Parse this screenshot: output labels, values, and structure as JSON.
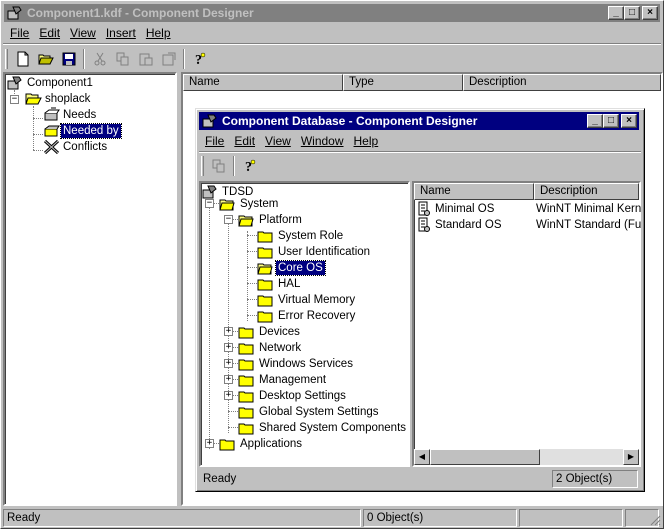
{
  "main": {
    "title": "Component1.kdf - Component Designer",
    "menu": [
      "File",
      "Edit",
      "View",
      "Insert",
      "Help"
    ],
    "tree": [
      {
        "label": "Component1"
      },
      {
        "label": "shoplack"
      },
      {
        "label": "Needs"
      },
      {
        "label": "Needed by"
      },
      {
        "label": "Conflicts"
      }
    ],
    "columns": [
      "Name",
      "Type",
      "Description"
    ],
    "status": [
      "Ready",
      "0 Object(s)",
      "",
      ""
    ]
  },
  "child": {
    "title": "Component Database - Component Designer",
    "menu": [
      "File",
      "Edit",
      "View",
      "Window",
      "Help"
    ],
    "tree": [
      {
        "label": "TDSD"
      },
      {
        "label": "System"
      },
      {
        "label": "Platform"
      },
      {
        "label": "System Role"
      },
      {
        "label": "User Identification"
      },
      {
        "label": "Core OS"
      },
      {
        "label": "HAL"
      },
      {
        "label": "Virtual Memory"
      },
      {
        "label": "Error Recovery"
      },
      {
        "label": "Devices"
      },
      {
        "label": "Network"
      },
      {
        "label": "Windows Services"
      },
      {
        "label": "Management"
      },
      {
        "label": "Desktop Settings"
      },
      {
        "label": "Global System Settings"
      },
      {
        "label": "Shared System Components"
      },
      {
        "label": "Applications"
      }
    ],
    "columns": [
      "Name",
      "Description"
    ],
    "rows": [
      {
        "name": "Minimal OS",
        "description": "WinNT Minimal Kerne"
      },
      {
        "name": "Standard OS",
        "description": "WinNT Standard (Fu"
      }
    ],
    "status": [
      "Ready",
      "2 Object(s)"
    ]
  }
}
